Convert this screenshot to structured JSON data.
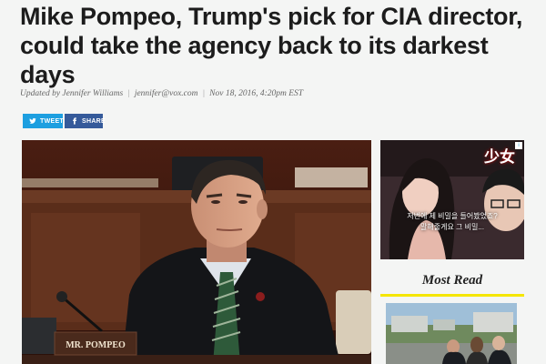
{
  "article": {
    "headline": "Mike Pompeo, Trump's pick for CIA director, could take the agency back to its darkest days",
    "byline_updated": "Updated by Jennifer Williams",
    "byline_email": "jennifer@vox.com",
    "byline_date": "Nov 18, 2016, 4:20pm EST"
  },
  "share": {
    "tweet_label": "TWEET",
    "facebook_label": "SHARE"
  },
  "photo": {
    "nameplate": "MR. POMPEO"
  },
  "ad": {
    "title_glyph": "少女",
    "line1": "저번에 제 비밀을 들어봤었죠?",
    "line2": "말해줄게요 그 비밀..."
  },
  "sidebar": {
    "most_read_label": "Most Read"
  },
  "colors": {
    "twitter": "#1d9fe0",
    "facebook": "#355a9a",
    "most_read_rule": "#f5e600"
  }
}
